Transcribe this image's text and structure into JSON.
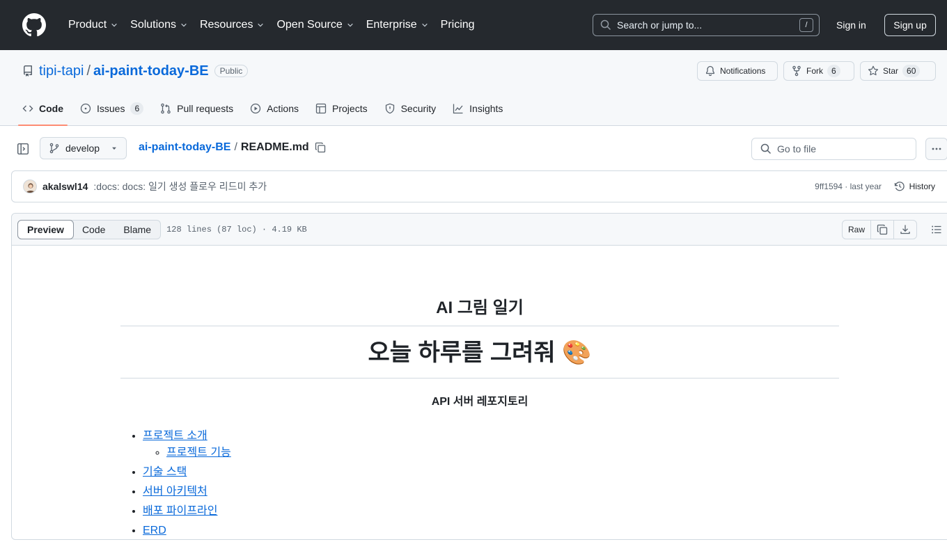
{
  "topnav": {
    "items": [
      {
        "label": "Product",
        "caret": true
      },
      {
        "label": "Solutions",
        "caret": true
      },
      {
        "label": "Resources",
        "caret": true
      },
      {
        "label": "Open Source",
        "caret": true
      },
      {
        "label": "Enterprise",
        "caret": true
      },
      {
        "label": "Pricing",
        "caret": false
      }
    ],
    "search_placeholder": "Search or jump to...",
    "search_key": "/",
    "signin": "Sign in",
    "signup": "Sign up"
  },
  "repo": {
    "owner": "tipi-tapi",
    "separator": "/",
    "name": "ai-paint-today-BE",
    "visibility": "Public",
    "notifications": "Notifications",
    "fork_label": "Fork",
    "fork_count": "6",
    "star_label": "Star",
    "star_count": "60"
  },
  "reponav": {
    "code": "Code",
    "issues": "Issues",
    "issues_count": "6",
    "pulls": "Pull requests",
    "actions": "Actions",
    "projects": "Projects",
    "security": "Security",
    "insights": "Insights"
  },
  "path": {
    "branch": "develop",
    "repo_link": "ai-paint-today-BE",
    "separator": "/",
    "file": "README.md",
    "goto_placeholder": "Go to file"
  },
  "commit": {
    "author": "akalswl14",
    "message": ":docs: docs: 일기 생성 플로우 리드미 추가",
    "meta": "9ff1594 · last year",
    "history": "History"
  },
  "file": {
    "tabs": [
      "Preview",
      "Code",
      "Blame"
    ],
    "info": "128 lines (87 loc) · 4.19 KB",
    "raw": "Raw"
  },
  "readme": {
    "h3": "AI 그림 일기",
    "h1": "오늘 하루를 그려줘 🎨",
    "subtitle": "API 서버 레포지토리",
    "toc": {
      "item1": "프로젝트 소개",
      "item1_sub": "프로젝트 기능",
      "item2": "기술 스택",
      "item3": "서버 아키텍처",
      "item4": "배포 파이프라인",
      "item5": "ERD"
    }
  }
}
